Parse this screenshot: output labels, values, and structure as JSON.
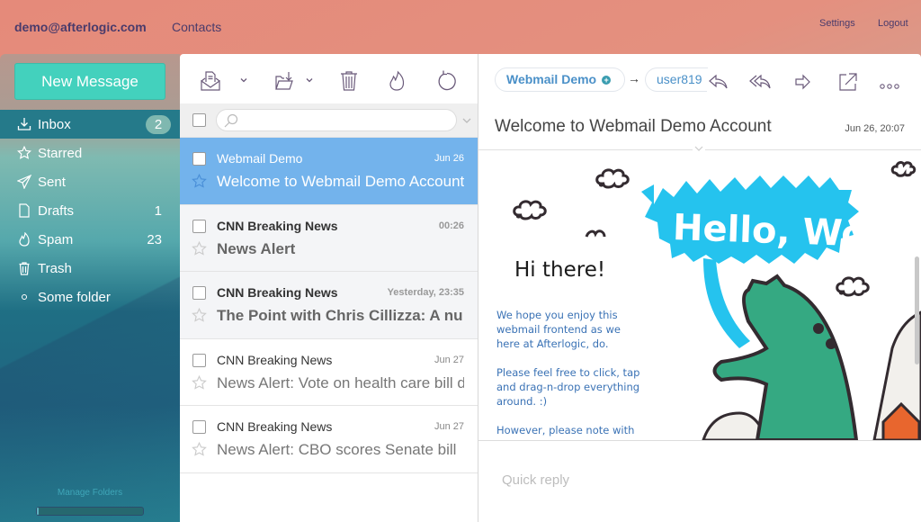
{
  "topbar": {
    "account": "demo@afterlogic.com",
    "contacts": "Contacts",
    "settings": "Settings",
    "logout": "Logout"
  },
  "sidebar": {
    "new_message": "New Message",
    "folders": [
      {
        "label": "Inbox",
        "icon": "inbox-download-icon",
        "unread_badge": "2",
        "active": true
      },
      {
        "label": "Starred",
        "icon": "star-icon",
        "count": ""
      },
      {
        "label": "Sent",
        "icon": "paper-plane-icon",
        "count": ""
      },
      {
        "label": "Drafts",
        "icon": "document-icon",
        "count": "1"
      },
      {
        "label": "Spam",
        "icon": "flame-icon",
        "count": "23"
      },
      {
        "label": "Trash",
        "icon": "trash-icon",
        "count": ""
      },
      {
        "label": "Some folder",
        "icon": "circle-dot-icon",
        "count": ""
      }
    ],
    "manage_folders": "Manage Folders",
    "quota_used_fraction": 0.01
  },
  "toolbar": {
    "buttons": [
      "check-mail-icon",
      "move-to-folder-icon",
      "delete-icon",
      "spam-icon",
      "refresh-icon"
    ]
  },
  "search": {
    "value": "",
    "placeholder": ""
  },
  "messages": [
    {
      "from": "Webmail Demo",
      "date": "Jun 26",
      "subject": "Welcome to Webmail Demo Account",
      "selected": true,
      "unread": false
    },
    {
      "from": "CNN Breaking News",
      "date": "00:26",
      "subject": "News Alert",
      "selected": false,
      "unread": true
    },
    {
      "from": "CNN Breaking News",
      "date": "Yesterday, 23:35",
      "subject": "The Point with Chris Cillizza: A nu",
      "selected": false,
      "unread": true
    },
    {
      "from": "CNN Breaking News",
      "date": "Jun 27",
      "subject": "News Alert: Vote on health care bill delayed",
      "selected": false,
      "unread": false
    },
    {
      "from": "CNN Breaking News",
      "date": "Jun 27",
      "subject": "News Alert: CBO scores Senate bill",
      "selected": false,
      "unread": false
    }
  ],
  "viewer": {
    "from_name": "Webmail Demo",
    "arrow": "→",
    "to_name": "user819",
    "subject": "Welcome to Webmail Demo Account",
    "date": "Jun 26, 20:07",
    "body": {
      "greeting": "Hi there!",
      "banner_text": "Hello, World!",
      "paragraphs": [
        "We hope you enjoy this webmail frontend as we here at Afterlogic, do.",
        "Please feel free to click, tap and drag-n-drop everything around. :)",
        "However, please note with this demo account you can"
      ]
    },
    "quick_reply_placeholder": "Quick reply"
  },
  "colors": {
    "accent_button": "#43d1bd",
    "selected_row": "#73b3ec",
    "link_blue": "#4a90c8",
    "body_text_blue": "#3a72b5",
    "header_text": "#4a3b6b"
  }
}
